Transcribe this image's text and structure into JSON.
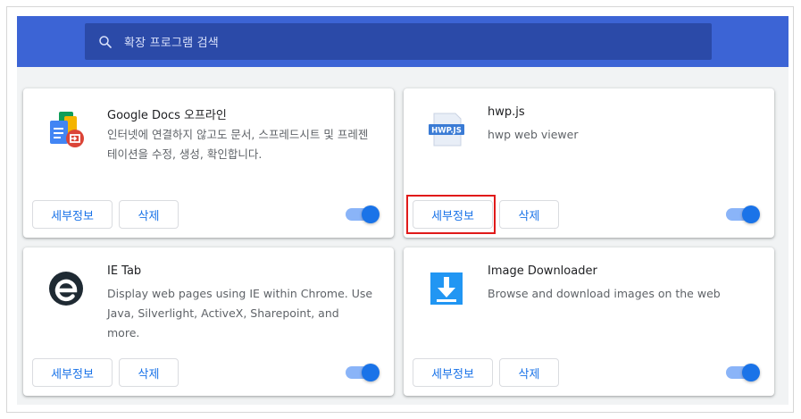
{
  "search": {
    "placeholder": "확장 프로그램 검색"
  },
  "extensions": [
    {
      "name": "Google Docs 오프라인",
      "description": "인터넷에 연결하지 않고도 문서, 스프레드시트 및 프레젠테이션을 수정, 생성, 확인합니다.",
      "details_label": "세부정보",
      "remove_label": "삭제",
      "enabled": true,
      "icon": "google-docs-offline-icon"
    },
    {
      "name": "hwp.js",
      "description": "hwp web viewer",
      "details_label": "세부정보",
      "remove_label": "삭제",
      "enabled": true,
      "icon": "hwpjs-icon",
      "icon_text": "HWP.JS"
    },
    {
      "name": "IE Tab",
      "description": "Display web pages using IE within Chrome. Use Java, Silverlight, ActiveX, Sharepoint, and more.",
      "details_label": "세부정보",
      "remove_label": "삭제",
      "enabled": true,
      "icon": "ie-tab-icon"
    },
    {
      "name": "Image Downloader",
      "description": "Browse and download images on the web",
      "details_label": "세부정보",
      "remove_label": "삭제",
      "enabled": true,
      "icon": "download-arrow-icon"
    }
  ],
  "colors": {
    "header": "#3c64d5",
    "search_bg": "#2b4aa8",
    "accent": "#1a73e8",
    "highlight": "#e01a1a"
  }
}
